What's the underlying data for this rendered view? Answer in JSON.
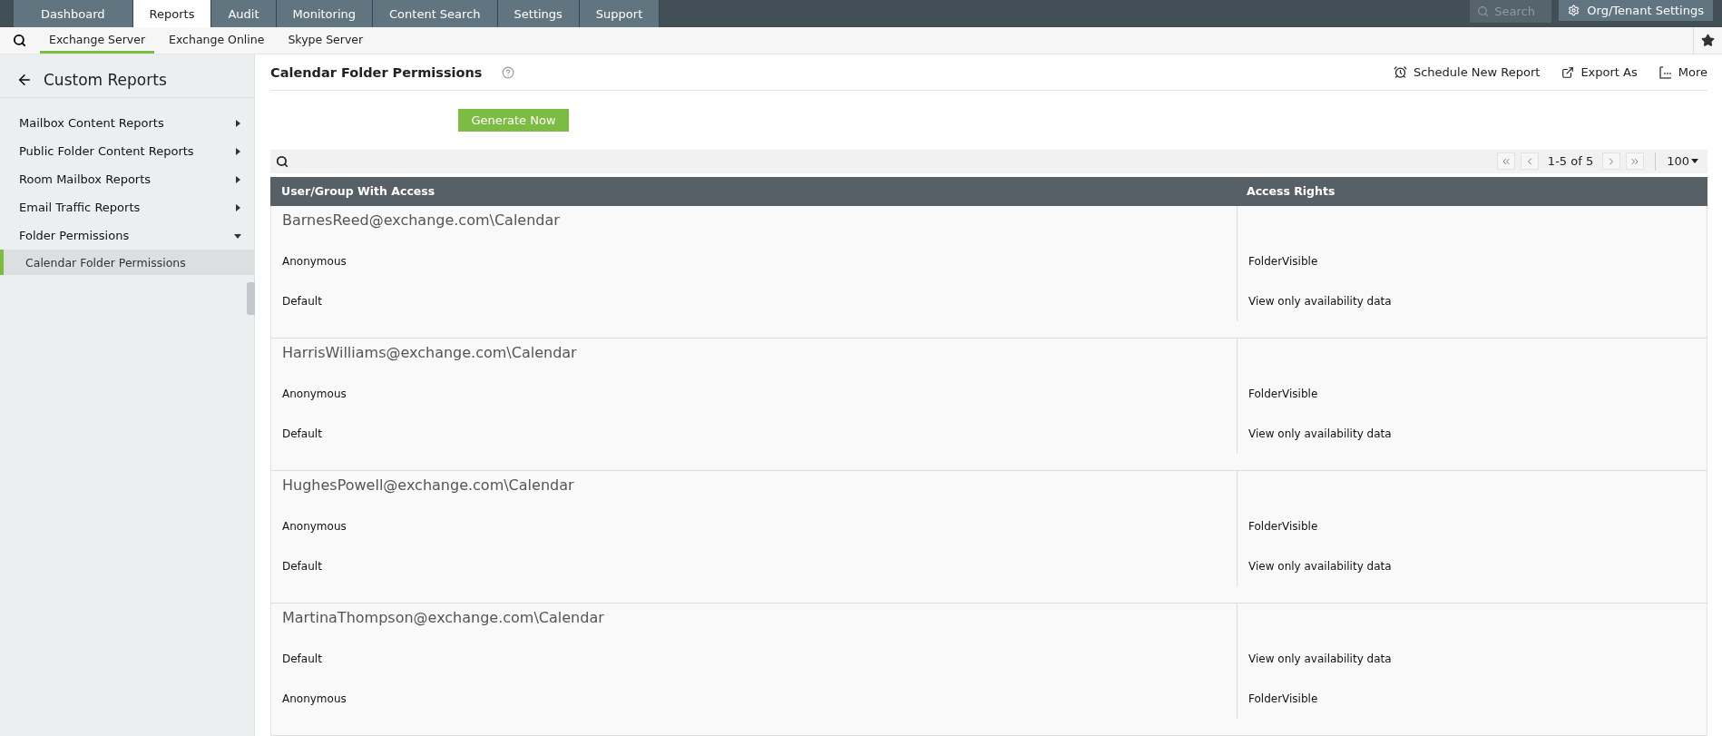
{
  "top_nav": {
    "tabs": [
      {
        "label": "Dashboard",
        "selected": false
      },
      {
        "label": "Reports",
        "selected": true
      },
      {
        "label": "Audit",
        "selected": false
      },
      {
        "label": "Monitoring",
        "selected": false
      },
      {
        "label": "Content Search",
        "selected": false
      },
      {
        "label": "Settings",
        "selected": false
      },
      {
        "label": "Support",
        "selected": false
      }
    ],
    "search": {
      "placeholder": "Search"
    },
    "settings_button": "Org/Tenant Settings"
  },
  "sub_nav": {
    "tabs": [
      {
        "label": "Exchange Server",
        "selected": true
      },
      {
        "label": "Exchange Online",
        "selected": false
      },
      {
        "label": "Skype Server",
        "selected": false
      }
    ]
  },
  "sidebar": {
    "title": "Custom Reports",
    "items": [
      {
        "label": "Mailbox Content Reports",
        "expanded": false
      },
      {
        "label": "Public Folder Content Reports",
        "expanded": false
      },
      {
        "label": "Room Mailbox Reports",
        "expanded": false
      },
      {
        "label": "Email Traffic Reports",
        "expanded": false
      },
      {
        "label": "Folder Permissions",
        "expanded": true,
        "children": [
          {
            "label": "Calendar Folder Permissions",
            "selected": true
          }
        ]
      }
    ]
  },
  "report": {
    "title": "Calendar Folder Permissions",
    "actions": [
      "Schedule New Report",
      "Export As",
      "More"
    ],
    "generate_button": "Generate Now",
    "pagination": {
      "range": "1-5 of 5",
      "page_size": "100"
    },
    "table": {
      "columns": [
        "User/Group With Access",
        "Access Rights"
      ],
      "groups": [
        {
          "folder": "BarnesReed@exchange.com\\Calendar",
          "rows": [
            [
              "Anonymous",
              "FolderVisible"
            ],
            [
              "Default",
              "View only availability data"
            ]
          ]
        },
        {
          "folder": "HarrisWilliams@exchange.com\\Calendar",
          "rows": [
            [
              "Anonymous",
              "FolderVisible"
            ],
            [
              "Default",
              "View only availability data"
            ]
          ]
        },
        {
          "folder": "HughesPowell@exchange.com\\Calendar",
          "rows": [
            [
              "Anonymous",
              "FolderVisible"
            ],
            [
              "Default",
              "View only availability data"
            ]
          ]
        },
        {
          "folder": "MartinaThompson@exchange.com\\Calendar",
          "rows": [
            [
              "Default",
              "View only availability data"
            ],
            [
              "Anonymous",
              "FolderVisible"
            ]
          ]
        }
      ]
    }
  }
}
